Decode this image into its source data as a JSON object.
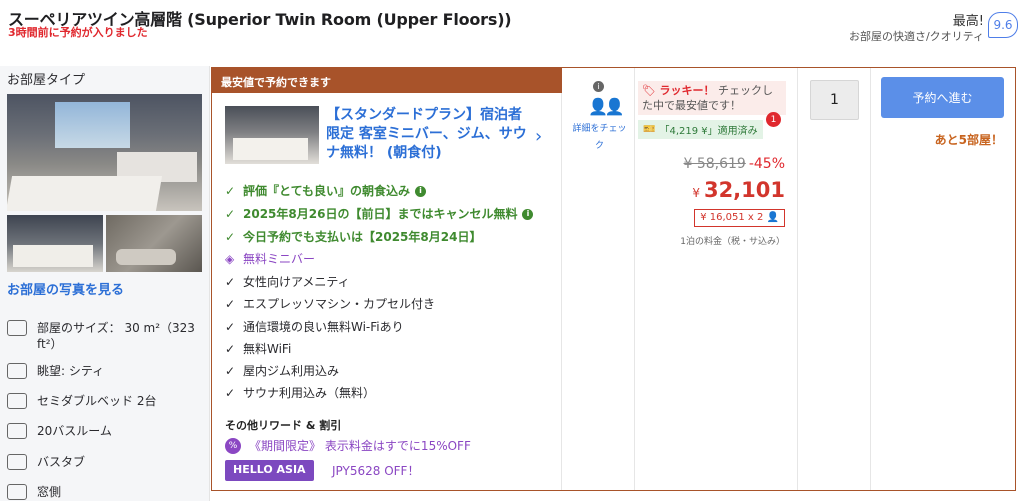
{
  "header": {
    "room_title": "スーペリアツイン高層階 (Superior Twin Room (Upper Floors))",
    "booked_recently": "3時間前に予約が入りました",
    "rating_word": "最高!",
    "rating_sub": "お部屋の快適さ/クオリティ",
    "rating_score": "9.6"
  },
  "room": {
    "type_label": "お部屋タイプ",
    "photos_link": "お部屋の写真を見る",
    "amenities": [
      {
        "icon": "room-size-icon",
        "text": "部屋のサイズ： 30 m²（323 ft²）"
      },
      {
        "icon": "view-icon",
        "text": "眺望: シティ"
      },
      {
        "icon": "bed-icon",
        "text": "セミダブルベッド 2台"
      },
      {
        "icon": "bathroom-icon",
        "text": "20バスルーム"
      },
      {
        "icon": "bathtub-icon",
        "text": "バスタブ"
      },
      {
        "icon": "window-icon",
        "text": "窓側"
      }
    ]
  },
  "offer": {
    "banner": "最安値で予約できます",
    "plan_title": "【スタンダードプラン】宿泊者限定 客室ミニバー、ジム、サウナ無料！ (朝食付)",
    "green_features": [
      "評価『とても良い』の朝食込み",
      "2025年8月26日の【前日】まではキャンセル無料",
      "今日予約でも支払いは【2025年8月24日】"
    ],
    "minibar": "無料ミニバー",
    "features": [
      "女性向けアメニティ",
      "エスプレッソマシン・カプセル付き",
      "通信環境の良い無料Wi-Fiあり",
      "無料WiFi",
      "屋内ジム利用込み",
      "サウナ利用込み（無料）"
    ],
    "rewards_heading": "その他リワード & 割引",
    "reward_promo": "《期間限定》 表示料金はすでに15%OFF",
    "hello_asia": "HELLO ASIA",
    "jpy_off": "JPY5628 OFF！"
  },
  "occupancy": {
    "link": "詳細をチェック"
  },
  "pricing": {
    "lucky_label": "ラッキー！",
    "lucky_text": "チェックした中で最安値です！",
    "coupon": "「4,219 ¥」適用済み",
    "coupon_count": "1",
    "old_price": "¥ 58,619",
    "discount": "-45%",
    "currency": "¥",
    "price": "32,101",
    "per_person": "¥ 16,051 x 2",
    "note": "1泊の料金（税・サ込み）"
  },
  "booking": {
    "quantity": "1",
    "button": "予約へ進む",
    "rooms_left": "あと5部屋！"
  }
}
